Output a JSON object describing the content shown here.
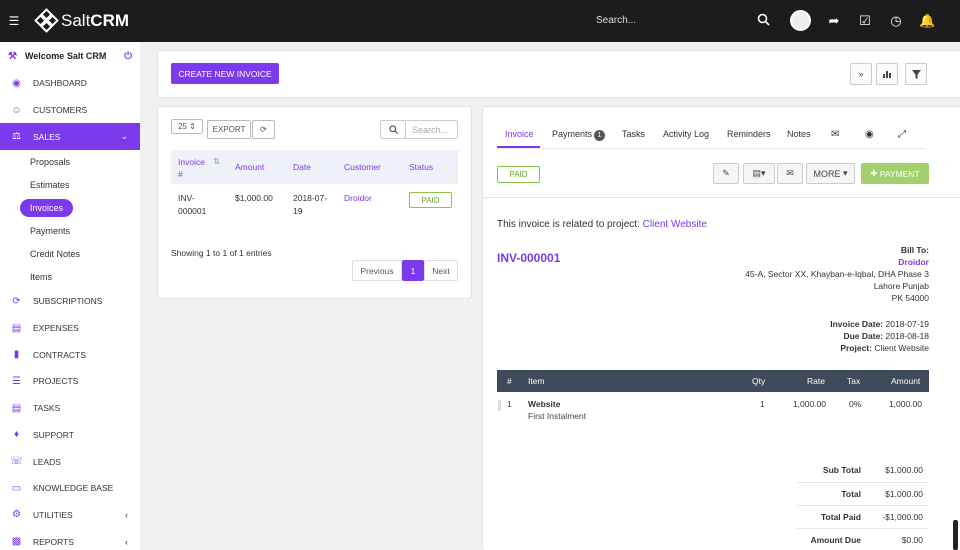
{
  "app": {
    "brand_light": "Salt",
    "brand_bold": "CRM",
    "search": "Search..."
  },
  "sidebar": {
    "welcome": "Welcome Salt CRM",
    "items": [
      {
        "label": "DASHBOARD",
        "icon": "dashboard-icon"
      },
      {
        "label": "CUSTOMERS",
        "icon": "user-icon"
      },
      {
        "label": "SALES",
        "icon": "balance-scale-icon"
      },
      {
        "label": "SUBSCRIPTIONS",
        "icon": "refresh-icon"
      },
      {
        "label": "EXPENSES",
        "icon": "file-text-icon"
      },
      {
        "label": "CONTRACTS",
        "icon": "file-icon"
      },
      {
        "label": "PROJECTS",
        "icon": "bars-icon"
      },
      {
        "label": "TASKS",
        "icon": "tasks-icon"
      },
      {
        "label": "SUPPORT",
        "icon": "ticket-icon"
      },
      {
        "label": "LEADS",
        "icon": "tty-icon"
      },
      {
        "label": "KNOWLEDGE BASE",
        "icon": "folder-open-icon"
      },
      {
        "label": "UTILITIES",
        "icon": "cogs-icon"
      },
      {
        "label": "REPORTS",
        "icon": "chart-icon"
      }
    ],
    "sales_sub": [
      "Proposals",
      "Estimates",
      "Invoices",
      "Payments",
      "Credit Notes",
      "Items"
    ]
  },
  "toolbar": {
    "create_label": "CREATE NEW INVOICE"
  },
  "list": {
    "page_size": "25",
    "export_label": "EXPORT",
    "search_placeholder": "Search...",
    "headers": {
      "invoice": "Invoice #",
      "amount": "Amount",
      "date": "Date",
      "customer": "Customer",
      "status": "Status"
    },
    "row": {
      "invoice_a": "INV-",
      "invoice_b": "000001",
      "amount": "$1,000.00",
      "date_a": "2018-07-",
      "date_b": "19",
      "customer": "Droidor",
      "status": "PAID"
    },
    "showing": "Showing 1 to 1 of 1 entries",
    "prev": "Previous",
    "page": "1",
    "next": "Next"
  },
  "detail": {
    "tabs": {
      "invoice": "Invoice",
      "payments": "Payments",
      "payments_count": "1",
      "tasks": "Tasks",
      "activity": "Activity Log",
      "reminders": "Reminders",
      "notes": "Notes"
    },
    "status": "PAID",
    "more_label": "MORE",
    "payment_label": "PAYMENT",
    "related_text": "This invoice is related to project: ",
    "related_link": "Client Website",
    "invoice_no": "INV-000001",
    "bill_to_label": "Bill To:",
    "bill_name": "Droidor",
    "addr1": "45-A, Sector XX, Khayban-e-Iqbal, DHA Phase 3",
    "addr2": "Lahore Punjab",
    "addr3": "PK 54000",
    "inv_date_label": "Invoice Date:",
    "inv_date": "2018-07-19",
    "due_date_label": "Due Date:",
    "due_date": "2018-08-18",
    "project_label": "Project:",
    "project": "Client Website",
    "items_head": {
      "num": "#",
      "item": "Item",
      "qty": "Qty",
      "rate": "Rate",
      "tax": "Tax",
      "amount": "Amount"
    },
    "item": {
      "num": "1",
      "name": "Website",
      "desc": "First Instalment",
      "qty": "1",
      "rate": "1,000.00",
      "tax": "0%",
      "amount": "1,000.00"
    },
    "totals": [
      {
        "label": "Sub Total",
        "value": "$1,000.00"
      },
      {
        "label": "Total",
        "value": "$1,000.00"
      },
      {
        "label": "Total Paid",
        "value": "-$1,000.00"
      },
      {
        "label": "Amount Due",
        "value": "$0.00"
      }
    ]
  },
  "colors": {
    "accent": "#7c3aed",
    "topbar": "#1c1c1c",
    "paid": "#8bc34a",
    "table_head": "#3d4a59"
  }
}
